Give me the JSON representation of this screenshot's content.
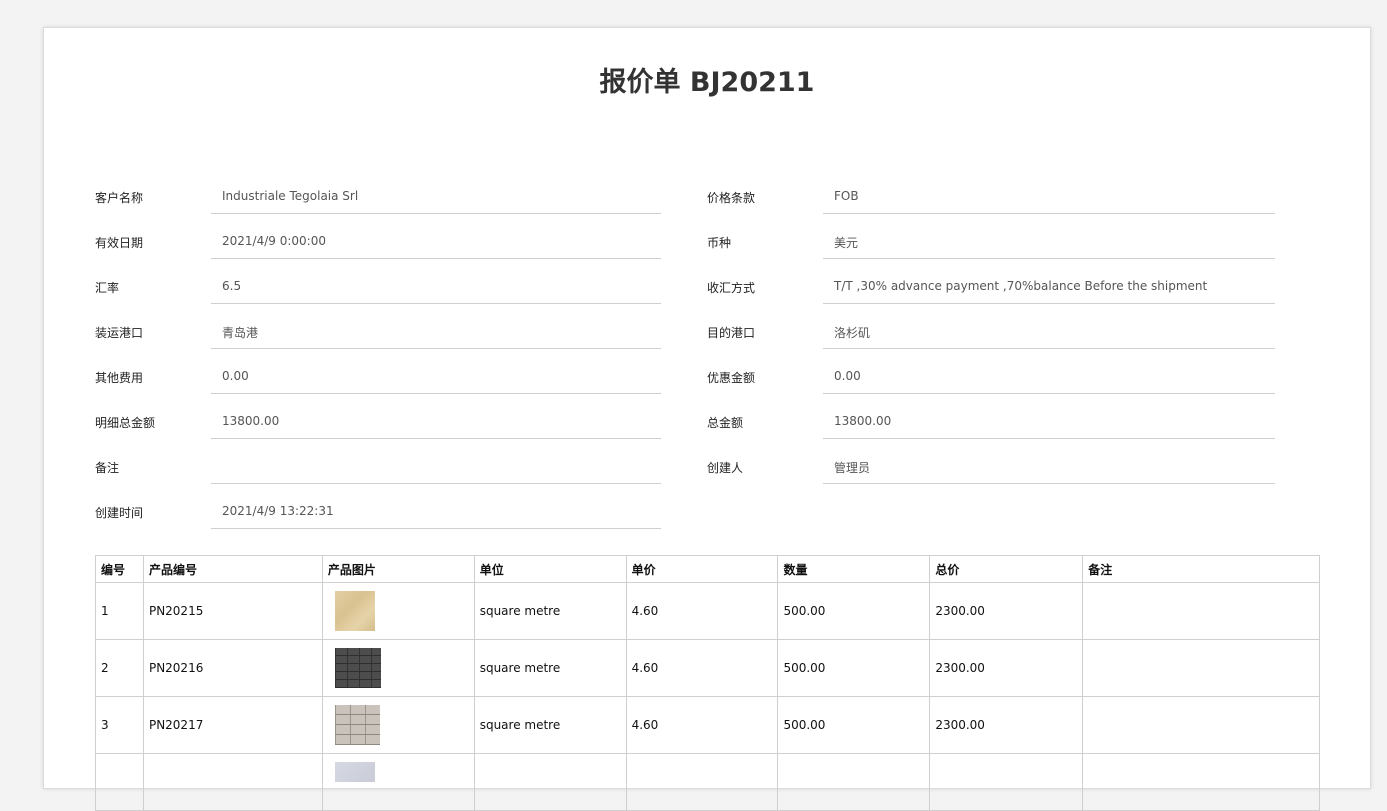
{
  "title": "报价单 BJ20211",
  "left_fields": [
    {
      "label": "客户名称",
      "value": "Industriale Tegolaia Srl"
    },
    {
      "label": "有效日期",
      "value": "2021/4/9 0:00:00"
    },
    {
      "label": "汇率",
      "value": "6.5"
    },
    {
      "label": "装运港口",
      "value": "青岛港"
    },
    {
      "label": "其他费用",
      "value": "0.00"
    },
    {
      "label": "明细总金额",
      "value": "13800.00"
    },
    {
      "label": "备注",
      "value": ""
    },
    {
      "label": "创建时间",
      "value": "2021/4/9 13:22:31"
    }
  ],
  "right_fields": [
    {
      "label": "价格条款",
      "value": "FOB"
    },
    {
      "label": "币种",
      "value": "美元"
    },
    {
      "label": "收汇方式",
      "value": "T/T ,30% advance payment ,70%balance Before the shipment"
    },
    {
      "label": "目的港口",
      "value": "洛杉矶"
    },
    {
      "label": "优惠金额",
      "value": "0.00"
    },
    {
      "label": "总金额",
      "value": "13800.00"
    },
    {
      "label": "创建人",
      "value": "管理员"
    }
  ],
  "table": {
    "headers": [
      "编号",
      "产品编号",
      "产品图片",
      "单位",
      "单价",
      "数量",
      "总价",
      "备注"
    ],
    "rows": [
      {
        "no": "1",
        "code": "PN20215",
        "image": "beige-sandstone-tile",
        "unit": "square metre",
        "price": "4.60",
        "qty": "500.00",
        "total": "2300.00",
        "note": ""
      },
      {
        "no": "2",
        "code": "PN20216",
        "image": "dark-grey-brick-tile",
        "unit": "square metre",
        "price": "4.60",
        "qty": "500.00",
        "total": "2300.00",
        "note": ""
      },
      {
        "no": "3",
        "code": "PN20217",
        "image": "light-grey-brick-tile",
        "unit": "square metre",
        "price": "4.60",
        "qty": "500.00",
        "total": "2300.00",
        "note": ""
      },
      {
        "no": "",
        "code": "",
        "image": "pale-blue-grey-tile",
        "unit": "",
        "price": "",
        "qty": "",
        "total": "",
        "note": ""
      }
    ]
  }
}
